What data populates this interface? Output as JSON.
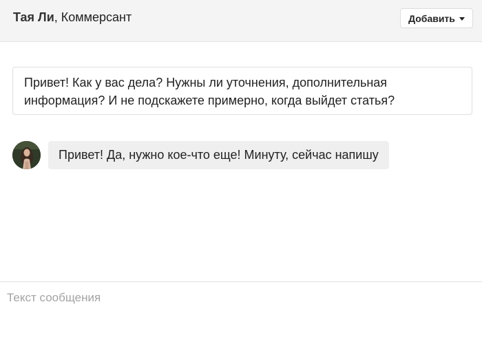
{
  "header": {
    "contact_name": "Тая Ли",
    "contact_org": ", Коммерсант",
    "add_button_label": "Добавить"
  },
  "messages": [
    {
      "direction": "outgoing",
      "text": "Привет! Как у вас дела? Нужны ли уточнения, дополнительная информация? И не подскажете примерно, когда выйдет статья?"
    },
    {
      "direction": "incoming",
      "text": "Привет! Да, нужно кое-что еще! Минуту, сейчас напишу"
    }
  ],
  "composer": {
    "placeholder": "Текст сообщения"
  },
  "icons": {
    "add_button_icon": "caret-down-icon"
  },
  "colors": {
    "header_bg": "#f4f4f4",
    "incoming_bubble_bg": "#efefef",
    "outgoing_bubble_border": "#dedede"
  }
}
